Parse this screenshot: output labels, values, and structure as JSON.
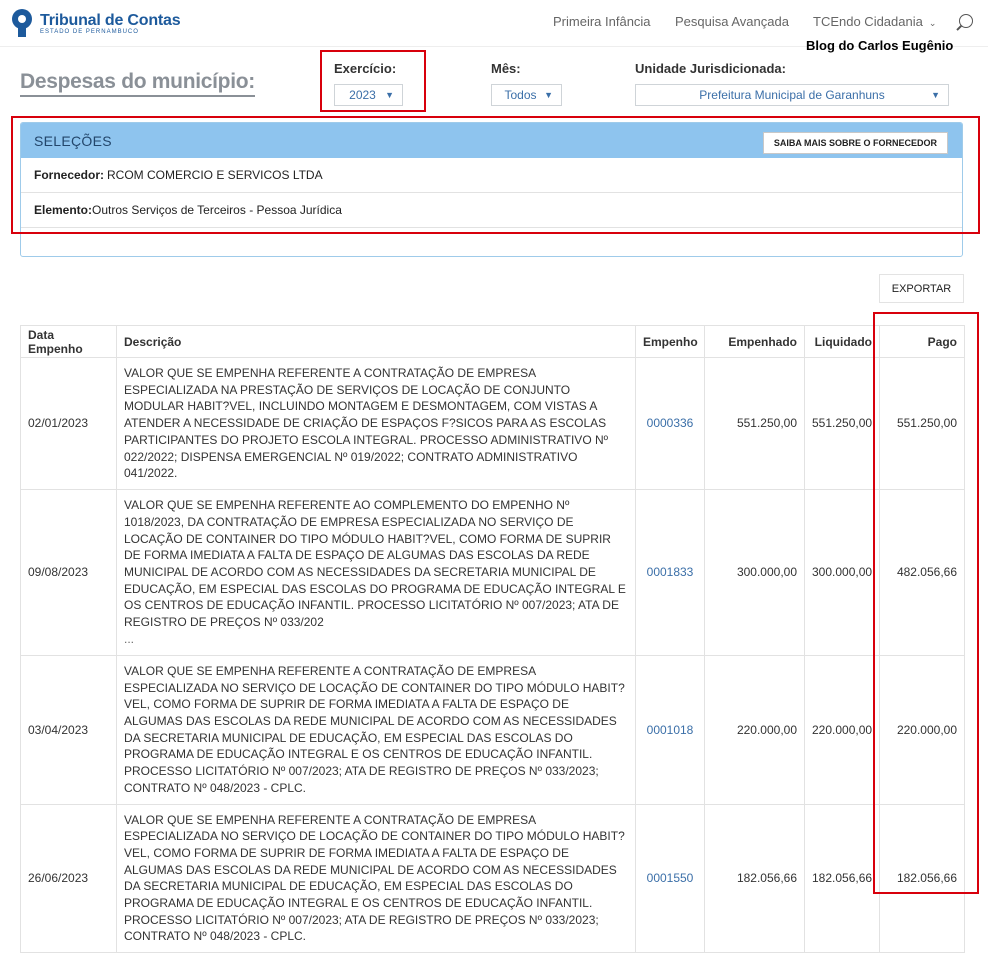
{
  "header": {
    "logo_name": "Tribunal de Contas",
    "logo_sub": "ESTADO DE PERNAMBUCO",
    "nav": [
      "Primeira Infância",
      "Pesquisa Avançada",
      "TCEndo Cidadania"
    ],
    "watermark": "Blog do Carlos Eugênio"
  },
  "filters": {
    "page_title": "Despesas do município:",
    "exercicio_label": "Exercício:",
    "exercicio_value": "2023",
    "mes_label": "Mês:",
    "mes_value": "Todos",
    "unidade_label": "Unidade Jurisdicionada:",
    "unidade_value": "Prefeitura Municipal de Garanhuns"
  },
  "selections": {
    "title": "SELEÇÕES",
    "button": "SAIBA MAIS SOBRE O FORNECEDOR",
    "fornecedor_label": "Fornecedor:",
    "fornecedor_value": "RCOM COMERCIO E SERVICOS LTDA",
    "elemento_label": "Elemento:",
    "elemento_value": "Outros Serviços de Terceiros - Pessoa Jurídica"
  },
  "export_label": "EXPORTAR",
  "table": {
    "headers": [
      "Data Empenho",
      "Descrição",
      "Empenho",
      "Empenhado",
      "Liquidado",
      "Pago"
    ],
    "rows": [
      {
        "data": "02/01/2023",
        "descricao": "VALOR QUE SE EMPENHA REFERENTE A CONTRATAÇÃO DE EMPRESA ESPECIALIZADA NA PRESTAÇÃO DE SERVIÇOS DE LOCAÇÃO DE CONJUNTO MODULAR HABIT?VEL, INCLUINDO MONTAGEM E DESMONTAGEM, COM VISTAS A ATENDER A NECESSIDADE DE CRIAÇÃO DE ESPAÇOS F?SICOS PARA AS ESCOLAS PARTICIPANTES DO PROJETO ESCOLA INTEGRAL. PROCESSO ADMINISTRATIVO Nº 022/2022; DISPENSA EMERGENCIAL Nº 019/2022; CONTRATO ADMINISTRATIVO 041/2022.",
        "empenho": "0000336",
        "empenhado": "551.250,00",
        "liquidado": "551.250,00",
        "pago": "551.250,00"
      },
      {
        "data": "09/08/2023",
        "descricao": "VALOR QUE SE EMPENHA REFERENTE AO COMPLEMENTO DO EMPENHO Nº 1018/2023, DA CONTRATAÇÃO DE EMPRESA ESPECIALIZADA NO SERVIÇO DE LOCAÇÃO DE CONTAINER DO TIPO MÓDULO HABIT?VEL, COMO FORMA DE SUPRIR DE FORMA IMEDIATA A FALTA DE ESPAÇO DE ALGUMAS DAS ESCOLAS DA REDE MUNICIPAL DE ACORDO COM AS NECESSIDADES DA SECRETARIA MUNICIPAL DE EDUCAÇÃO, EM ESPECIAL DAS ESCOLAS DO PROGRAMA DE EDUCAÇÃO INTEGRAL E OS CENTROS DE EDUCAÇÃO INFANTIL. PROCESSO LICITATÓRIO Nº 007/2023; ATA DE REGISTRO DE PREÇOS Nº 033/202",
        "ellipsis": "...",
        "empenho": "0001833",
        "empenhado": "300.000,00",
        "liquidado": "300.000,00",
        "pago": "482.056,66"
      },
      {
        "data": "03/04/2023",
        "descricao": "VALOR QUE SE EMPENHA REFERENTE A CONTRATAÇÃO DE EMPRESA ESPECIALIZADA NO SERVIÇO DE LOCAÇÃO DE CONTAINER DO TIPO MÓDULO HABIT?VEL, COMO FORMA DE SUPRIR DE FORMA IMEDIATA A FALTA DE ESPAÇO DE ALGUMAS DAS ESCOLAS DA REDE MUNICIPAL DE ACORDO COM AS NECESSIDADES DA SECRETARIA MUNICIPAL DE EDUCAÇÃO, EM ESPECIAL DAS ESCOLAS DO PROGRAMA DE EDUCAÇÃO INTEGRAL E OS CENTROS DE EDUCAÇÃO INFANTIL. PROCESSO LICITATÓRIO Nº 007/2023; ATA DE REGISTRO DE PREÇOS Nº 033/2023; CONTRATO Nº 048/2023 - CPLC.",
        "empenho": "0001018",
        "empenhado": "220.000,00",
        "liquidado": "220.000,00",
        "pago": "220.000,00"
      },
      {
        "data": "26/06/2023",
        "descricao": "VALOR QUE SE EMPENHA REFERENTE A CONTRATAÇÃO DE EMPRESA ESPECIALIZADA NO SERVIÇO DE LOCAÇÃO DE CONTAINER DO TIPO MÓDULO HABIT?VEL, COMO FORMA DE SUPRIR DE FORMA IMEDIATA A FALTA DE ESPAÇO DE ALGUMAS DAS ESCOLAS DA REDE MUNICIPAL DE ACORDO COM AS NECESSIDADES DA SECRETARIA MUNICIPAL DE EDUCAÇÃO, EM ESPECIAL DAS ESCOLAS DO PROGRAMA DE EDUCAÇÃO INTEGRAL E OS CENTROS DE EDUCAÇÃO INFANTIL. PROCESSO LICITATÓRIO Nº 007/2023; ATA DE REGISTRO DE PREÇOS Nº 033/2023; CONTRATO Nº 048/2023 - CPLC.",
        "empenho": "0001550",
        "empenhado": "182.056,66",
        "liquidado": "182.056,66",
        "pago": "182.056,66"
      }
    ]
  },
  "colors": {
    "accent": "#1d5a9c",
    "link": "#3b6fa8",
    "panel_header": "#8ec4ee",
    "highlight": "#d8000c"
  }
}
